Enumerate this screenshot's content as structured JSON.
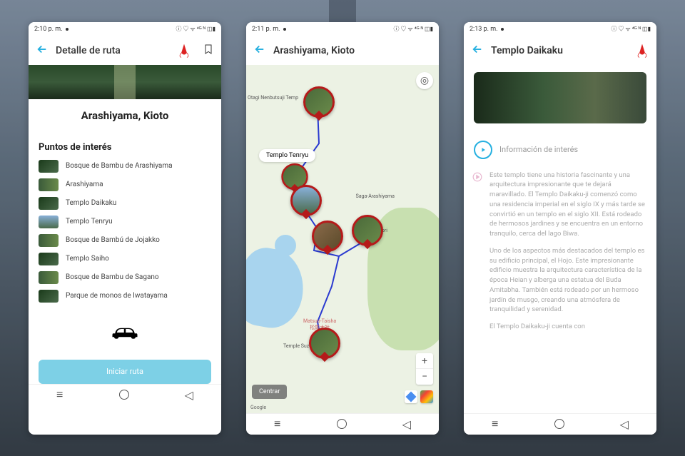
{
  "screen1": {
    "status_time": "2:10 p. m.",
    "header_title": "Detalle de ruta",
    "route_title": "Arashiyama, Kioto",
    "section": "Puntos de interés",
    "poi": [
      "Bosque de Bambu de Arashiyama",
      "Arashiyama",
      "Templo Daikaku",
      "Templo Tenryu",
      "Bosque de Bambú de Jojakko",
      "Templo Saiho",
      "Bosque de Bambu de Sagano",
      "Parque de monos de Iwatayama"
    ],
    "start_label": "Iniciar ruta"
  },
  "screen2": {
    "status_time": "2:11 p. m.",
    "header_title": "Arashiyama, Kioto",
    "callout": "Templo Tenryu",
    "centrar": "Centrar",
    "google": "Google",
    "labels": {
      "otagi": "Otagi Nenbutsuji Temp",
      "saga": "Saga-Arashiyama",
      "sanjo": "Sanjo dori",
      "matsuo": "Matsuo-Taisha\n松尾大社",
      "tenryu": "Templo Tenryu",
      "suzumi": "Temple Suzum"
    }
  },
  "screen3": {
    "status_time": "2:13 p. m.",
    "header_title": "Templo Daikaku",
    "info_title": "Información de interés",
    "p1": "Este templo tiene una historia fascinante y una arquitectura impresionante que te dejará maravillado. El Templo Daikaku-ji comenzó como una residencia imperial en el siglo IX y más tarde se convirtió en un templo en el siglo XII. Está rodeado de hermosos jardines y se encuentra en un entorno tranquilo, cerca del lago Biwa.",
    "p2": "Uno de los aspectos más destacados del templo es su edificio principal, el Hojo. Este impresionante edificio muestra la arquitectura característica de la época Heian y alberga una estatua del Buda Amitabha. También está rodeado por un hermoso jardín de musgo, creando una atmósfera de tranquilidad y serenidad.",
    "p3": "El Templo Daikaku-ji cuenta con"
  },
  "status_icons": "ⓘ ♡ ᯤ ⁴ᴳ ᴺ ◫▮"
}
